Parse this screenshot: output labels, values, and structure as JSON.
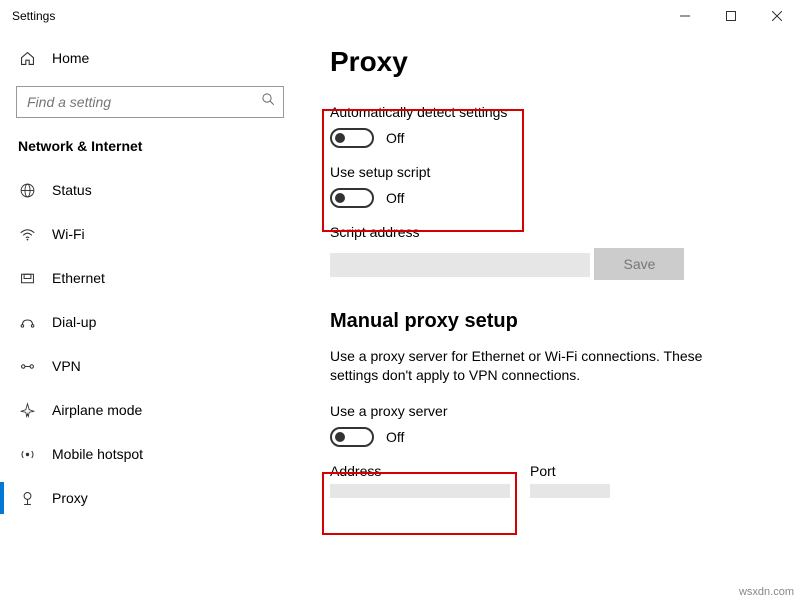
{
  "window": {
    "title": "Settings"
  },
  "sidebar": {
    "home_label": "Home",
    "search_placeholder": "Find a setting",
    "category": "Network & Internet",
    "items": [
      {
        "label": "Status"
      },
      {
        "label": "Wi-Fi"
      },
      {
        "label": "Ethernet"
      },
      {
        "label": "Dial-up"
      },
      {
        "label": "VPN"
      },
      {
        "label": "Airplane mode"
      },
      {
        "label": "Mobile hotspot"
      },
      {
        "label": "Proxy"
      }
    ]
  },
  "main": {
    "title": "Proxy",
    "auto_detect": {
      "label": "Automatically detect settings",
      "state": "Off"
    },
    "setup_script": {
      "label": "Use setup script",
      "state": "Off"
    },
    "script_address_label": "Script address",
    "save_label": "Save",
    "manual": {
      "title": "Manual proxy setup",
      "desc": "Use a proxy server for Ethernet or Wi-Fi connections. These settings don't apply to VPN connections.",
      "use_proxy": {
        "label": "Use a proxy server",
        "state": "Off"
      },
      "address_label": "Address",
      "port_label": "Port"
    }
  },
  "watermark": "wsxdn.com"
}
